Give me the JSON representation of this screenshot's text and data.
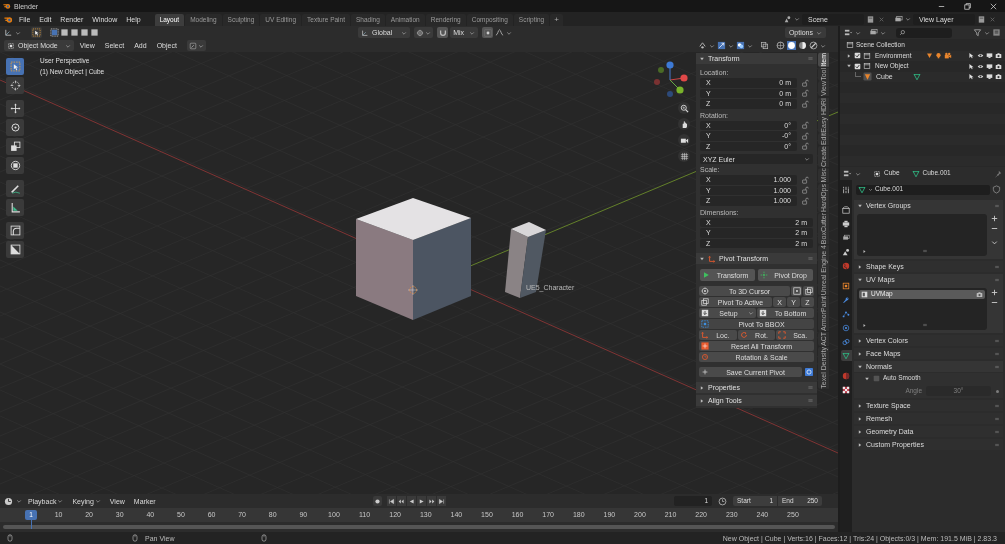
{
  "window": {
    "title": "Blender"
  },
  "menu": [
    "File",
    "Edit",
    "Render",
    "Window",
    "Help"
  ],
  "workspaces": [
    {
      "label": "Layout",
      "selected": true
    },
    {
      "label": "Modeling",
      "selected": false
    },
    {
      "label": "Sculpting",
      "selected": false
    },
    {
      "label": "UV Editing",
      "selected": false
    },
    {
      "label": "Texture Paint",
      "selected": false
    },
    {
      "label": "Shading",
      "selected": false
    },
    {
      "label": "Animation",
      "selected": false
    },
    {
      "label": "Rendering",
      "selected": false
    },
    {
      "label": "Compositing",
      "selected": false
    },
    {
      "label": "Scripting",
      "selected": false
    }
  ],
  "add_workspace": "+",
  "scene": "Scene",
  "view_layer": "View Layer",
  "tool_header": {
    "orientation": "Global",
    "snapping": "Mix",
    "options": "Options"
  },
  "viewport_header": {
    "mode": "Object Mode",
    "menus": [
      "View",
      "Select",
      "Add",
      "Object"
    ]
  },
  "viewport": {
    "perspective": "User Perspective",
    "object_info": "(1) New Object | Cube",
    "object_label": "UE5_Character"
  },
  "toolbar": [
    {
      "kind": "select",
      "selected": true
    },
    {
      "kind": "cursor",
      "selected": false
    },
    {
      "kind": "move",
      "selected": false
    },
    {
      "kind": "rotate",
      "selected": false
    },
    {
      "kind": "scale",
      "selected": false
    },
    {
      "kind": "transform",
      "selected": false
    },
    {
      "kind": "annotate",
      "selected": false
    },
    {
      "kind": "measure",
      "selected": false
    },
    {
      "kind": "corner",
      "selected": false
    },
    {
      "kind": "diagonal",
      "selected": false
    }
  ],
  "sidebar_tabs": [
    {
      "label": "Item",
      "selected": true
    },
    {
      "label": "Tool",
      "selected": false
    },
    {
      "label": "View",
      "selected": false
    },
    {
      "label": "Easy HDRI",
      "selected": false
    },
    {
      "label": "Edit",
      "selected": false
    },
    {
      "label": "Create",
      "selected": false
    },
    {
      "label": "Misc",
      "selected": false
    },
    {
      "label": "HardOps",
      "selected": false
    },
    {
      "label": "BoxCutter",
      "selected": false
    },
    {
      "label": "Unreal Engine 4",
      "selected": false
    },
    {
      "label": "ArmorPaint",
      "selected": false
    },
    {
      "label": "ACT",
      "selected": false
    },
    {
      "label": "Texel Density",
      "selected": false
    }
  ],
  "transform": {
    "title": "Transform",
    "expanded": true,
    "location": {
      "label": "Location:",
      "fields": [
        {
          "axis": "X",
          "value": "0 m",
          "locked": false
        },
        {
          "axis": "Y",
          "value": "0 m",
          "locked": false
        },
        {
          "axis": "Z",
          "value": "0 m",
          "locked": false
        }
      ]
    },
    "rotation": {
      "label": "Rotation:",
      "fields": [
        {
          "axis": "X",
          "value": "0°",
          "locked": false
        },
        {
          "axis": "Y",
          "value": "-0°",
          "locked": false
        },
        {
          "axis": "Z",
          "value": "0°",
          "locked": false
        }
      ]
    },
    "rotation_mode": "XYZ Euler",
    "scale": {
      "label": "Scale:",
      "fields": [
        {
          "axis": "X",
          "value": "1.000",
          "locked": false
        },
        {
          "axis": "Y",
          "value": "1.000",
          "locked": false
        },
        {
          "axis": "Z",
          "value": "1.000",
          "locked": false
        }
      ]
    },
    "dimensions": {
      "label": "Dimensions:",
      "fields": [
        {
          "axis": "X",
          "value": "2 m"
        },
        {
          "axis": "Y",
          "value": "2 m"
        },
        {
          "axis": "Z",
          "value": "2 m"
        }
      ]
    }
  },
  "pivot_transform": {
    "title": "Pivot Transform",
    "expanded": true,
    "rows": [
      {
        "buttons": [
          {
            "kind": "play",
            "label": "Transform"
          },
          {
            "kind": "drop",
            "label": "Pivot Drop"
          }
        ]
      },
      {
        "buttons": [
          {
            "kind": "target",
            "label": "To 3D Cursor"
          },
          {
            "kind": "dot-square"
          },
          {
            "kind": "squares"
          }
        ]
      },
      {
        "buttons": [
          {
            "kind": "squares",
            "label": "Pivot To Active"
          },
          {
            "label": "X"
          },
          {
            "label": "Y"
          },
          {
            "label": "Z"
          }
        ]
      },
      {
        "buttons": [
          {
            "kind": "menu",
            "label": "Setup"
          },
          {
            "kind": "down",
            "label": "To Bottom"
          }
        ]
      },
      {
        "buttons": [
          {
            "kind": "bbox",
            "label": "Pivot To BBOX"
          }
        ]
      },
      {
        "buttons": [
          {
            "kind": "loc",
            "label": "Loc."
          },
          {
            "kind": "rot",
            "label": "Rot."
          },
          {
            "kind": "sca",
            "label": "Sca."
          }
        ]
      },
      {
        "buttons": [
          {
            "kind": "reset",
            "label": "Reset All Transform"
          }
        ]
      },
      {
        "buttons": [
          {
            "kind": "rotscale",
            "label": "Rotation & Scale"
          }
        ]
      },
      {
        "buttons": [
          {
            "kind": "plus",
            "label": "Save Current Pivot"
          },
          {
            "kind": "blue"
          }
        ]
      }
    ]
  },
  "collapsed_panels": [
    {
      "title": "Properties",
      "expanded": false
    },
    {
      "title": "Align Tools",
      "expanded": false
    }
  ],
  "outliner": {
    "root": "Scene Collection",
    "items": [
      {
        "label": "Environment",
        "kind": "collection",
        "checked": true,
        "expanded": false
      },
      {
        "label": "New Object",
        "kind": "collection",
        "checked": true,
        "expanded": true,
        "children": [
          {
            "label": "Cube",
            "kind": "mesh",
            "expanded": false
          }
        ]
      }
    ]
  },
  "properties": {
    "object": "Cube",
    "data": "Cube.001",
    "mesh_name": "Cube.001",
    "tabs": [
      {
        "kind": "tool",
        "selected": false
      },
      {
        "kind": "render",
        "selected": false
      },
      {
        "kind": "output",
        "selected": false
      },
      {
        "kind": "view-layer",
        "selected": false
      },
      {
        "kind": "scene",
        "selected": false
      },
      {
        "kind": "world",
        "selected": false
      },
      {
        "kind": "object",
        "selected": false
      },
      {
        "kind": "modifier",
        "selected": false
      },
      {
        "kind": "particles",
        "selected": false
      },
      {
        "kind": "physics",
        "selected": false
      },
      {
        "kind": "constraints",
        "selected": false
      },
      {
        "kind": "data",
        "selected": true
      },
      {
        "kind": "material",
        "selected": false
      },
      {
        "kind": "texture",
        "selected": false
      }
    ],
    "panels": [
      {
        "title": "Vertex Groups",
        "expanded": true,
        "kind": "list"
      },
      {
        "title": "Shape Keys",
        "expanded": false
      },
      {
        "title": "UV Maps",
        "expanded": true,
        "kind": "list",
        "items": [
          {
            "label": "UVMap",
            "selected": true
          }
        ]
      },
      {
        "title": "Vertex Colors",
        "expanded": false
      },
      {
        "title": "Face Maps",
        "expanded": false
      },
      {
        "title": "Normals",
        "expanded": true,
        "kind": "normals",
        "auto_smooth": {
          "label": "Auto Smooth",
          "checked": false,
          "expanded": true
        },
        "angle": {
          "label": "Angle",
          "value": "30°"
        }
      },
      {
        "title": "Texture Space",
        "expanded": false
      },
      {
        "title": "Remesh",
        "expanded": false
      },
      {
        "title": "Geometry Data",
        "expanded": false
      },
      {
        "title": "Custom Properties",
        "expanded": false
      }
    ]
  },
  "timeline": {
    "menus": [
      {
        "label": "Playback",
        "kind": "dropdown"
      },
      {
        "label": "Keying",
        "kind": "dropdown"
      },
      {
        "label": "View",
        "kind": "menu"
      },
      {
        "label": "Marker",
        "kind": "menu"
      }
    ],
    "current_frame": "1",
    "start_label": "Start",
    "start": "1",
    "end_label": "End",
    "end": "250",
    "playhead": "1",
    "ticks": [
      "10",
      "20",
      "30",
      "40",
      "50",
      "60",
      "70",
      "80",
      "90",
      "100",
      "110",
      "120",
      "130",
      "140",
      "150",
      "160",
      "170",
      "180",
      "190",
      "200",
      "210",
      "220",
      "230",
      "240",
      "250"
    ]
  },
  "status_bar": {
    "hint": "Pan View",
    "stats": "New Object | Cube | Verts:16 | Faces:12 | Tris:24 | Objects:0/3 | Mem: 191.5 MiB | 2.83.3"
  }
}
